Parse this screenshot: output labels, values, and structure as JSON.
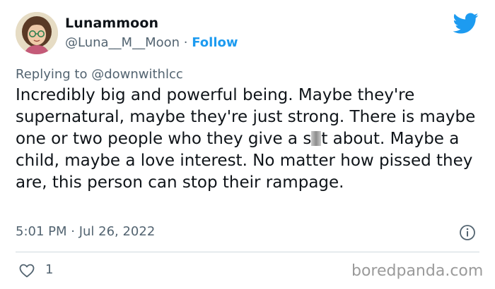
{
  "author": {
    "display_name": "Lunammoon",
    "handle": "@Luna__M__Moon",
    "separator": " · ",
    "follow_label": "Follow"
  },
  "reply": {
    "prefix": "Replying to ",
    "mention": "@downwithlcc"
  },
  "tweet": {
    "text_before": "Incredibly big and powerful being. Maybe they're supernatural, maybe they're just strong. There is maybe one or two people who they give a s",
    "text_after": "t about. Maybe a child, maybe a love interest. No matter how pissed they are, this person can stop their rampage.",
    "timestamp": "5:01 PM · Jul 26, 2022"
  },
  "engagement": {
    "like_count": "1"
  },
  "watermark": "boredpanda.com",
  "colors": {
    "accent": "#1d9bf0",
    "muted_text": "#536471",
    "text": "#0f1419",
    "divider": "#cfd9de"
  },
  "icons": {
    "brand": "twitter-bird-icon",
    "info": "info-icon",
    "like": "heart-icon"
  }
}
